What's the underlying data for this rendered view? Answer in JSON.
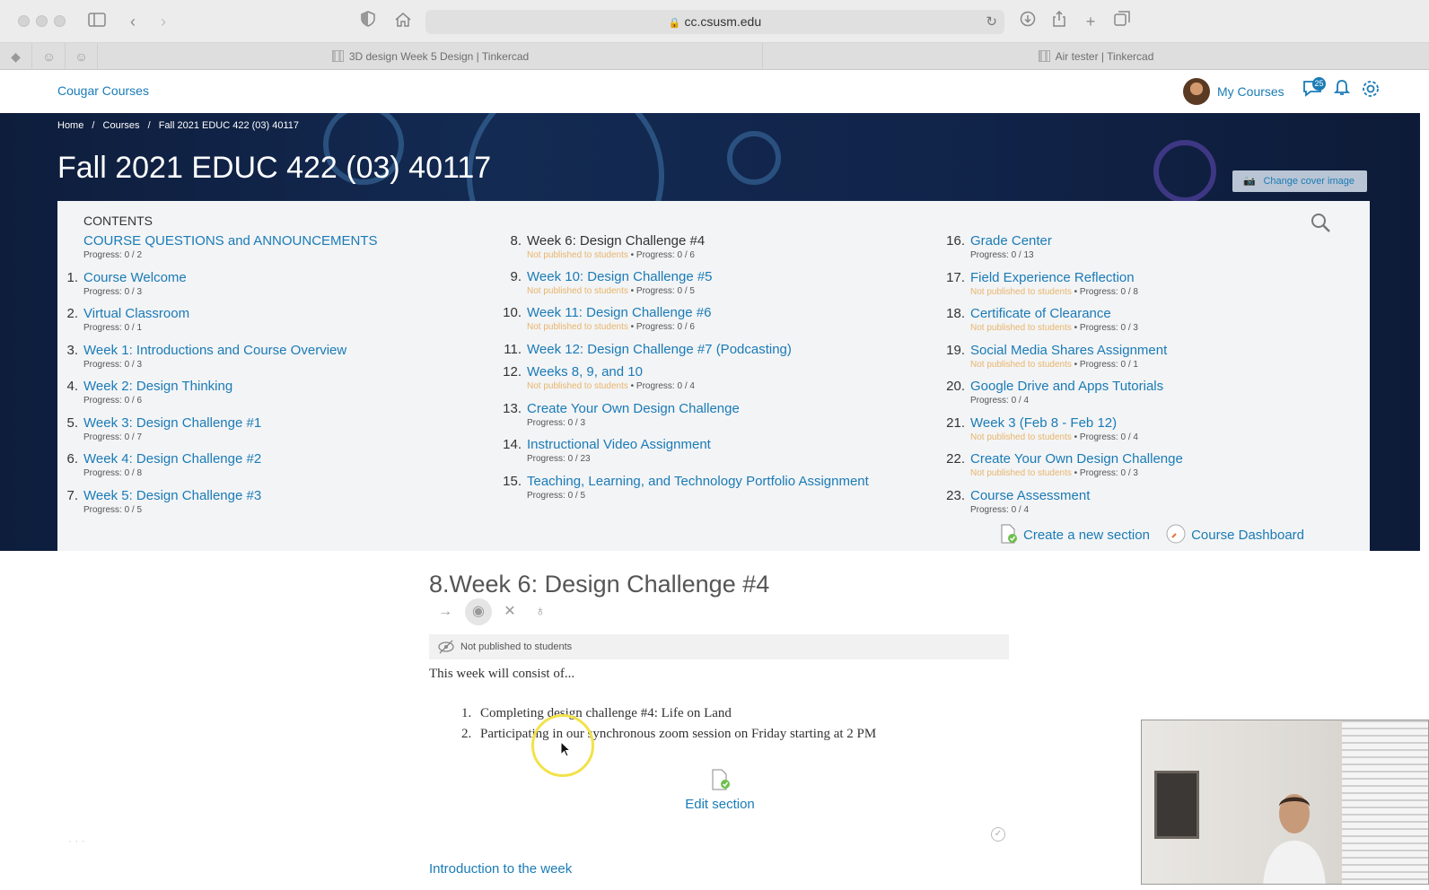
{
  "browser": {
    "url": "cc.csusm.edu",
    "tabs": [
      {
        "title": "3D design Week 5 Design | Tinkercad"
      },
      {
        "title": "Air tester | Tinkercad"
      }
    ]
  },
  "header": {
    "brand": "Cougar Courses",
    "my_courses": "My Courses",
    "message_count": "25"
  },
  "breadcrumb": [
    "Home",
    "/",
    "Courses",
    "/",
    "Fall 2021 EDUC 422 (03) 40117"
  ],
  "course_title": "Fall 2021 EDUC 422 (03) 40117",
  "cover_button": "Change cover image",
  "contents": {
    "label": "CONTENTS",
    "columns": [
      [
        {
          "num": "",
          "title": "COURSE QUESTIONS and ANNOUNCEMENTS",
          "not_published": "",
          "progress": "Progress: 0 / 2"
        },
        {
          "num": "1.",
          "title": "Course Welcome",
          "not_published": "",
          "progress": "Progress: 0 / 3"
        },
        {
          "num": "2.",
          "title": "Virtual Classroom",
          "not_published": "",
          "progress": "Progress: 0 / 1"
        },
        {
          "num": "3.",
          "title": "Week 1: Introductions and Course Overview",
          "not_published": "",
          "progress": "Progress: 0 / 3"
        },
        {
          "num": "4.",
          "title": "Week 2: Design Thinking",
          "not_published": "",
          "progress": "Progress: 0 / 6"
        },
        {
          "num": "5.",
          "title": "Week 3: Design Challenge #1",
          "not_published": "",
          "progress": "Progress: 0 / 7"
        },
        {
          "num": "6.",
          "title": "Week 4: Design Challenge #2",
          "not_published": "",
          "progress": "Progress: 0 / 8"
        },
        {
          "num": "7.",
          "title": "Week 5: Design Challenge #3",
          "not_published": "",
          "progress": "Progress: 0 / 5"
        }
      ],
      [
        {
          "num": "8.",
          "title": "Week 6: Design Challenge #4",
          "not_published": "Not published to students",
          "progress": "Progress: 0 / 6"
        },
        {
          "num": "9.",
          "title": "Week 10: Design Challenge #5",
          "not_published": "Not published to students",
          "progress": "Progress: 0 / 5"
        },
        {
          "num": "10.",
          "title": "Week 11: Design Challenge #6",
          "not_published": "Not published to students",
          "progress": "Progress: 0 / 6"
        },
        {
          "num": "11.",
          "title": "Week 12: Design Challenge #7 (Podcasting)",
          "not_published": "",
          "progress": ""
        },
        {
          "num": "12.",
          "title": "Weeks 8, 9, and 10",
          "not_published": "Not published to students",
          "progress": "Progress: 0 / 4"
        },
        {
          "num": "13.",
          "title": "Create Your Own Design Challenge",
          "not_published": "",
          "progress": "Progress: 0 / 3"
        },
        {
          "num": "14.",
          "title": "Instructional Video Assignment",
          "not_published": "",
          "progress": "Progress: 0 / 23"
        },
        {
          "num": "15.",
          "title": "Teaching, Learning, and Technology Portfolio Assignment",
          "not_published": "",
          "progress": "Progress: 0 / 5"
        }
      ],
      [
        {
          "num": "16.",
          "title": "Grade Center",
          "not_published": "",
          "progress": "Progress: 0 / 13"
        },
        {
          "num": "17.",
          "title": "Field Experience Reflection",
          "not_published": "Not published to students",
          "progress": "Progress: 0 / 8"
        },
        {
          "num": "18.",
          "title": "Certificate of Clearance",
          "not_published": "Not published to students",
          "progress": "Progress: 0 / 3"
        },
        {
          "num": "19.",
          "title": "Social Media Shares Assignment",
          "not_published": "Not published to students",
          "progress": "Progress: 0 / 1"
        },
        {
          "num": "20.",
          "title": "Google Drive and Apps Tutorials",
          "not_published": "",
          "progress": "Progress: 0 / 4"
        },
        {
          "num": "21.",
          "title": "Week 3 (Feb 8 - Feb 12)",
          "not_published": "Not published to students",
          "progress": "Progress: 0 / 4"
        },
        {
          "num": "22.",
          "title": "Create Your Own Design Challenge",
          "not_published": "Not published to students",
          "progress": "Progress: 0 / 3"
        },
        {
          "num": "23.",
          "title": "Course Assessment",
          "not_published": "",
          "progress": "Progress: 0 / 4"
        }
      ]
    ],
    "create_section": "Create a new section",
    "course_dashboard": "Course Dashboard"
  },
  "section": {
    "title": "8.Week 6: Design Challenge #4",
    "notice": "Not published to students",
    "intro": "This week will consist of...",
    "items": [
      {
        "num": "1.",
        "text": "Completing design challenge #4: Life on Land"
      },
      {
        "num": "2.",
        "text": "Participating in our synchronous zoom session on Friday starting at 2 PM"
      }
    ],
    "edit_label": "Edit section",
    "first_activity": "Introduction to the week"
  },
  "colors": {
    "link": "#1a7bb6",
    "not_published": "#e8b56a",
    "banner": "#132a52",
    "cursor_highlight": "#f2e24a"
  }
}
